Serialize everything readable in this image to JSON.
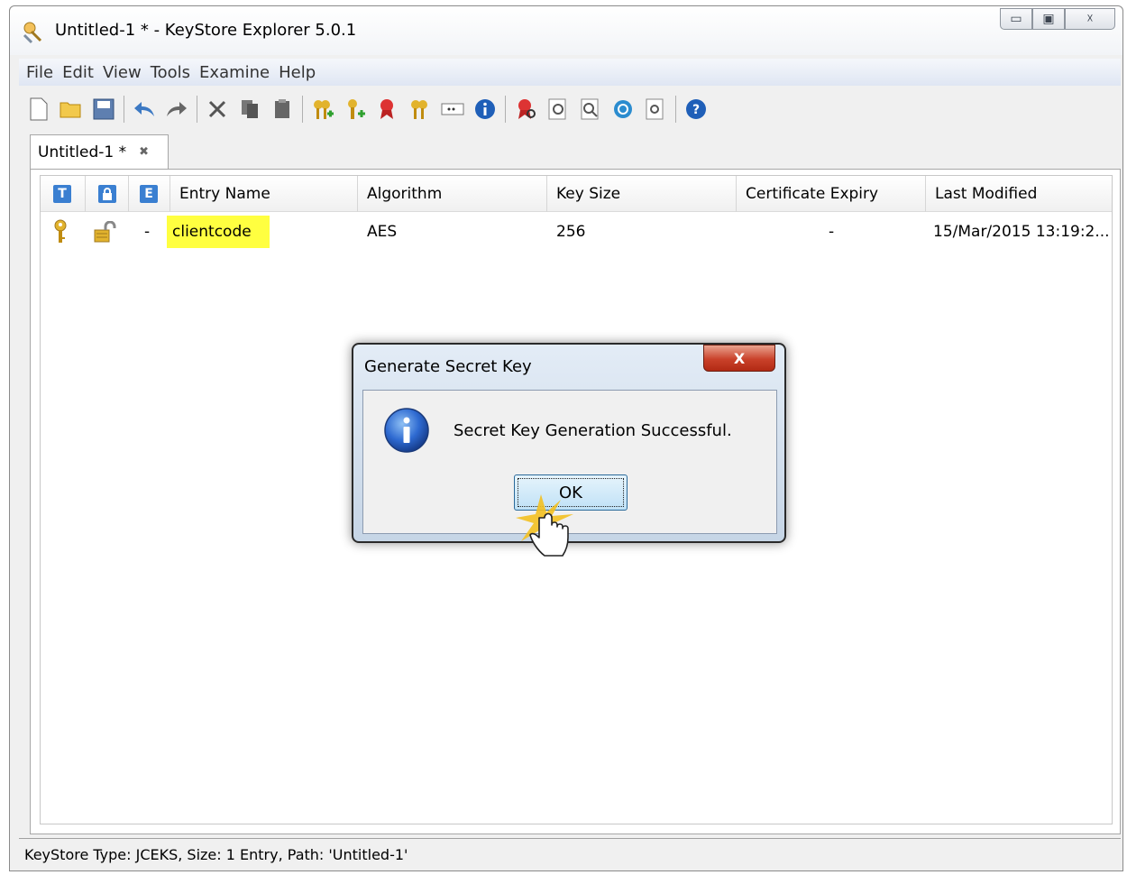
{
  "window": {
    "title": "Untitled-1 * - KeyStore Explorer 5.0.1",
    "controls": {
      "minimize": "▭",
      "maximize": "▣",
      "close": "☓"
    }
  },
  "menubar": {
    "items": [
      "File",
      "Edit",
      "View",
      "Tools",
      "Examine",
      "Help"
    ]
  },
  "toolbar": {
    "icons": [
      "new-icon",
      "open-icon",
      "save-icon",
      "undo-icon",
      "redo-icon",
      "cut-icon",
      "copy-icon",
      "paste-icon",
      "generate-keypair-icon",
      "generate-secret-key-icon",
      "import-trusted-cert-icon",
      "import-keypair-icon",
      "set-password-icon",
      "properties-icon",
      "examine-file-icon",
      "examine-clipboard-icon",
      "examine-ssl-icon",
      "examine-crl-icon",
      "detect-file-type-icon",
      "help-icon"
    ]
  },
  "tab": {
    "label": "Untitled-1 *",
    "close": "✖"
  },
  "table": {
    "columns": {
      "type_icon": "T",
      "lock_icon": "🔒",
      "expiry_icon": "E",
      "entry_name": "Entry Name",
      "algorithm": "Algorithm",
      "key_size": "Key Size",
      "cert_expiry": "Certificate Expiry",
      "last_modified": "Last Modified"
    },
    "rows": [
      {
        "expiry": "-",
        "entry_name": "clientcode",
        "algorithm": "AES",
        "key_size": "256",
        "cert_expiry": "-",
        "last_modified": "15/Mar/2015 13:19:2..."
      }
    ]
  },
  "status": {
    "text": "KeyStore Type: JCEKS, Size: 1 Entry, Path: 'Untitled-1'"
  },
  "dialog": {
    "title": "Generate Secret Key",
    "close": "X",
    "message": "Secret Key Generation Successful.",
    "ok_label": "OK"
  },
  "colors": {
    "highlight": "#ffff40",
    "accent": "#3a7fd1",
    "dialog_close": "#c9412a"
  }
}
